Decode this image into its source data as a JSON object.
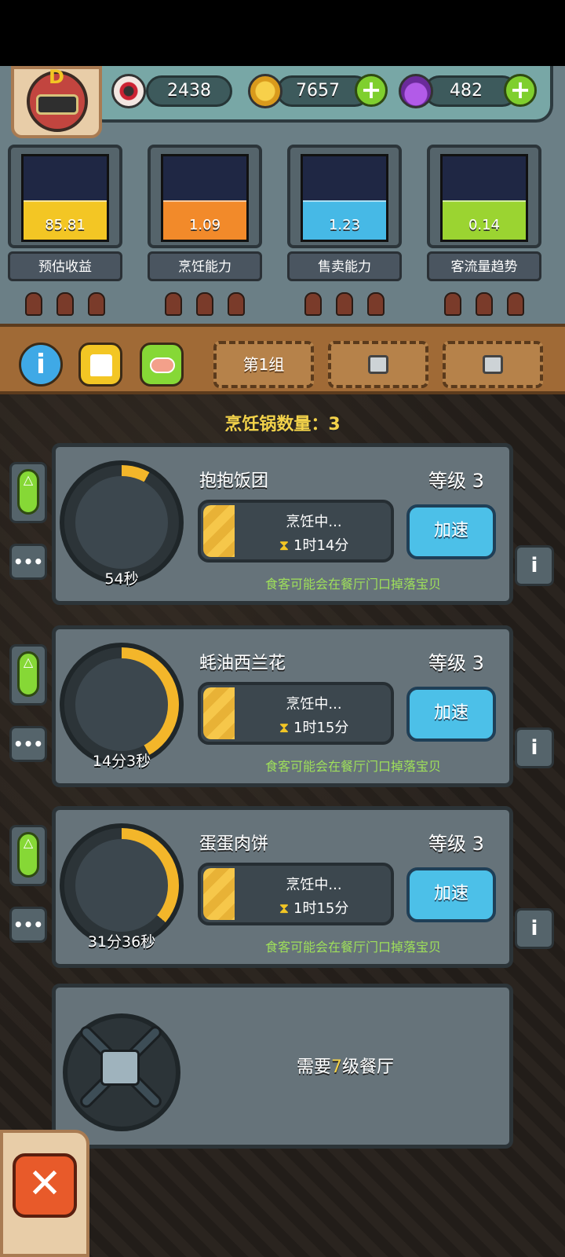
{
  "resources": {
    "eyeball": {
      "value": "2438",
      "icon": "eyeball-icon"
    },
    "coin": {
      "value": "7657",
      "icon": "coin-icon"
    },
    "potion": {
      "value": "482",
      "icon": "potion-icon"
    }
  },
  "avatar": {
    "rank": "D"
  },
  "stats": [
    {
      "value": "85.81",
      "label": "预估收益",
      "level": 0.45,
      "color": "#f3c624"
    },
    {
      "value": "1.09",
      "label": "烹饪能力",
      "level": 0.45,
      "color": "#f28a2a"
    },
    {
      "value": "1.23",
      "label": "售卖能力",
      "level": 0.45,
      "color": "#46b9e6"
    },
    {
      "value": "0.14",
      "label": "客流量趋势",
      "level": 0.45,
      "color": "#9bd431"
    }
  ],
  "tabs": {
    "group1": "第1组"
  },
  "pot_count": {
    "label": "烹饪锅数量：",
    "value": "3"
  },
  "pots": [
    {
      "name": "抱抱饭团",
      "level": "等级 3",
      "status": "烹饪中...",
      "time": "1时14分",
      "countdown": "54秒",
      "speed": "加速",
      "note": "食客可能会在餐厅门口掉落宝贝",
      "ring_progress": 0.08
    },
    {
      "name": "蚝油西兰花",
      "level": "等级 3",
      "status": "烹饪中...",
      "time": "1时15分",
      "countdown": "14分3秒",
      "speed": "加速",
      "note": "食客可能会在餐厅门口掉落宝贝",
      "ring_progress": 0.42
    },
    {
      "name": "蛋蛋肉饼",
      "level": "等级 3",
      "status": "烹饪中...",
      "time": "1时15分",
      "countdown": "31分36秒",
      "speed": "加速",
      "note": "食客可能会在餐厅门口掉落宝贝",
      "ring_progress": 0.36
    }
  ],
  "locked": {
    "prefix": "需要",
    "level": "7",
    "suffix": "级餐厅"
  },
  "ui": {
    "dots": "•••",
    "info": "i",
    "hourglass": "⧗",
    "close": "✕",
    "plus": "+",
    "up": "△"
  }
}
